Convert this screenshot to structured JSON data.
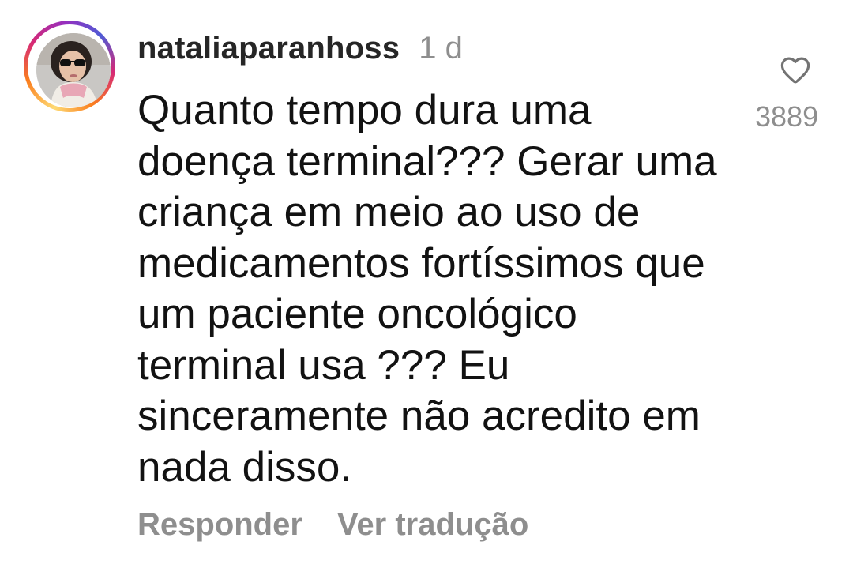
{
  "comment": {
    "username": "nataliaparanhoss",
    "time": "1 d",
    "text": "Quanto tempo dura uma\ndoença terminal??? Gerar uma\ncriança em meio ao uso de\nmedicamentos fortíssimos que\num paciente oncológico\nterminal usa ??? Eu\nsinceramente não acredito em\nnada disso.",
    "likes": "3889",
    "actions": {
      "reply": "Responder",
      "translate": "Ver tradução"
    }
  },
  "icons": {
    "like": "heart-outline-icon"
  },
  "colors": {
    "text": "#121212",
    "secondary": "#8e8e8e",
    "username": "#262626"
  }
}
